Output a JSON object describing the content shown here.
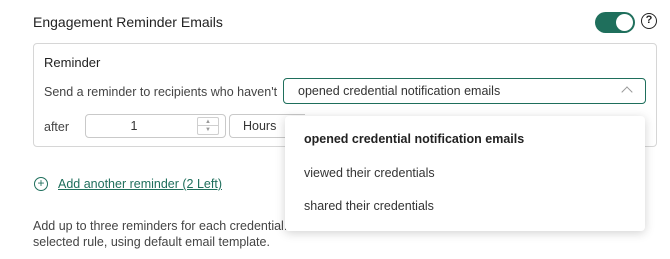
{
  "section": {
    "title": "Engagement Reminder Emails",
    "toggle_on": true,
    "help_icon": "question-circle-icon",
    "accent_color": "#1f6f5c"
  },
  "reminder_card": {
    "title": "Reminder",
    "send_label": "Send a reminder to recipients who haven't",
    "condition_value": "opened credential notification emails",
    "after_label": "after",
    "amount_value": "1",
    "unit_value": "Hours"
  },
  "dropdown": {
    "options": [
      "opened credential notification emails",
      "viewed their credentials",
      "shared their credentials"
    ],
    "selected_index": 0
  },
  "add_reminder": {
    "icon": "plus-circle-icon",
    "label": "Add another reminder (2 Left)"
  },
  "help_text": {
    "line1": "Add up to three reminders for each credential. T",
    "line2": "selected rule, using default email template."
  }
}
